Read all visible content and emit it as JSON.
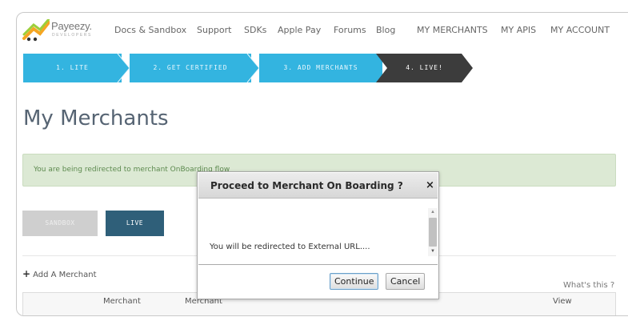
{
  "header": {
    "logo_word": "Payeezy.",
    "logo_sub": "DEVELOPERS",
    "nav": [
      "Docs & Sandbox",
      "Support",
      "SDKs",
      "Apple Pay",
      "Forums",
      "Blog",
      "MY MERCHANTS",
      "MY APIS",
      "MY ACCOUNT"
    ]
  },
  "steps": [
    "1. LITE",
    "2. GET CERTIFIED",
    "3. ADD MERCHANTS",
    "4. LIVE!"
  ],
  "page": {
    "title": "My Merchants",
    "alert": "You are being redirected to merchant OnBoarding flow",
    "env_buttons": {
      "sandbox": "SANDBOX",
      "live": "LIVE"
    },
    "add_merchant": "Add A Merchant",
    "whats_this": "What's this ?",
    "table_headers": [
      "Merchant",
      "Merchant",
      "View"
    ]
  },
  "modal": {
    "title": "Proceed to Merchant On Boarding ?",
    "close": "×",
    "body": "You will be redirected to External URL....",
    "continue": "Continue",
    "cancel": "Cancel"
  },
  "colors": {
    "step_blue": "#33b4e0",
    "step_active": "#3c3c3c",
    "live_button": "#2f5f79",
    "alert_bg": "#dce9d4"
  }
}
